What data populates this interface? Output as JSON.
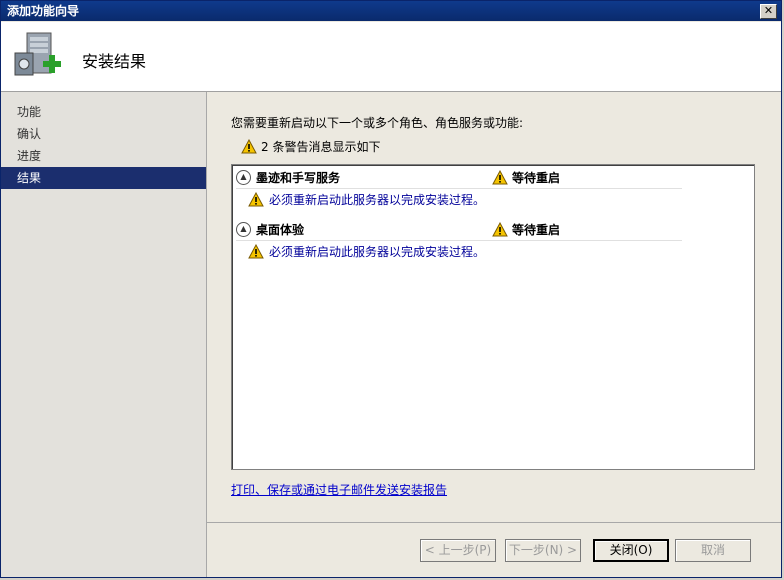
{
  "window": {
    "title": "添加功能向导"
  },
  "header": {
    "title": "安装结果"
  },
  "sidebar": {
    "items": [
      {
        "label": "功能",
        "active": false
      },
      {
        "label": "确认",
        "active": false
      },
      {
        "label": "进度",
        "active": false
      },
      {
        "label": "结果",
        "active": true
      }
    ]
  },
  "main": {
    "intro": "您需要重新启动以下一个或多个角色、角色服务或功能:",
    "warning_summary": "2 条警告消息显示如下",
    "results": [
      {
        "name": "墨迹和手写服务",
        "status": "等待重启",
        "message": "必须重新启动此服务器以完成安装过程。"
      },
      {
        "name": "桌面体验",
        "status": "等待重启",
        "message": "必须重新启动此服务器以完成安装过程。"
      }
    ],
    "report_link": "打印、保存或通过电子邮件发送安装报告"
  },
  "buttons": {
    "back": "< 上一步(P)",
    "next": "下一步(N) >",
    "close": "关闭(O)",
    "cancel": "取消"
  },
  "colors": {
    "titlebar": "#0a246a",
    "selection": "#1b2e6e",
    "link": "#0000cc",
    "warning": "#f5c400"
  }
}
